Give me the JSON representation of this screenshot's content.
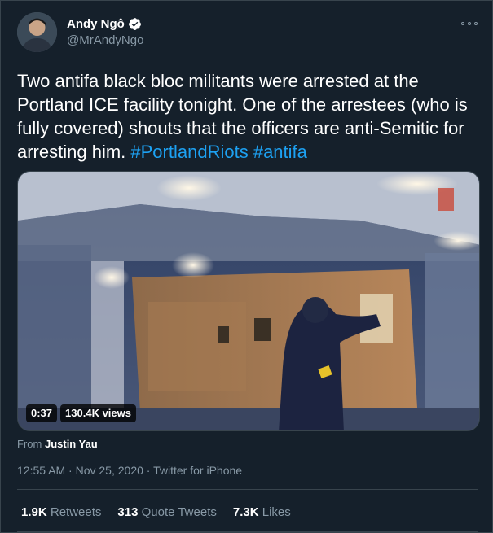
{
  "author": {
    "display_name": "Andy Ngô",
    "handle": "@MrAndyNgo",
    "verified": true
  },
  "tweet": {
    "text_before": "Two antifa black bloc militants were arrested at the Portland ICE facility tonight. One of the arrestees (who is fully covered) shouts that the officers are anti-Semitic for arresting him. ",
    "hashtags": [
      "#PortlandRiots",
      "#antifa"
    ]
  },
  "media": {
    "duration": "0:37",
    "views": "130.4K views"
  },
  "attribution": {
    "prefix": "From",
    "name": "Justin Yau"
  },
  "meta": {
    "time": "12:55 AM",
    "separator": "·",
    "date": "Nov 25, 2020",
    "source": "Twitter for iPhone"
  },
  "stats": {
    "retweets_count": "1.9K",
    "retweets_label": "Retweets",
    "quotes_count": "313",
    "quotes_label": "Quote Tweets",
    "likes_count": "7.3K",
    "likes_label": "Likes"
  },
  "colors": {
    "background": "#15202b",
    "accent": "#1da1f2",
    "muted": "#8899a6"
  },
  "icons": [
    "verified-badge-icon",
    "more-options-icon"
  ]
}
